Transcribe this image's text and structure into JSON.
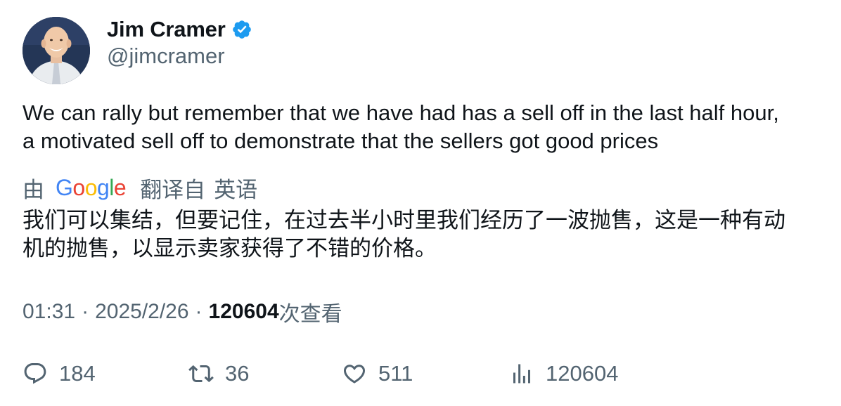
{
  "author": {
    "display_name": "Jim Cramer",
    "handle": "@jimcramer",
    "verified": true,
    "verified_color": "#1d9bf0"
  },
  "tweet": {
    "text_line1": "We can rally but remember that we have had has a sell off in the last half hour,",
    "text_line2": "a motivated sell off to demonstrate that the sellers got good prices"
  },
  "translation": {
    "by_label": "由",
    "provider": "Google",
    "translated_from_label": "翻译自",
    "source_language": "英语",
    "text_line1": "我们可以集结，但要记住，在过去半小时里我们经历了一波抛售，这是一种有动",
    "text_line2": "机的抛售，以显示卖家获得了不错的价格。"
  },
  "meta": {
    "time": "01:31",
    "separator": "·",
    "date": "2025/2/26",
    "views_count": "120604",
    "views_label": "次查看"
  },
  "actions": {
    "reply_count": "184",
    "retweet_count": "36",
    "like_count": "511",
    "views_count": "120604"
  },
  "icons": {
    "reply": "reply-icon",
    "retweet": "retweet-icon",
    "like": "heart-icon",
    "views": "analytics-icon",
    "verified": "verified-badge-icon"
  },
  "colors": {
    "text_primary": "#0f1419",
    "text_secondary": "#536471",
    "google_blue": "#4285f4",
    "google_red": "#ea4335",
    "google_yellow": "#fbbc05",
    "google_green": "#34a853"
  }
}
